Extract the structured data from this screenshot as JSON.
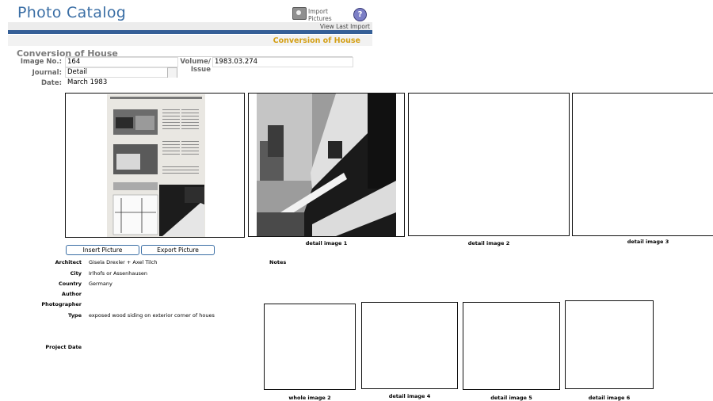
{
  "app": {
    "title": "Photo Catalog"
  },
  "toolbar": {
    "import_label": "Import Pictures",
    "import_icon": "import-pictures-icon",
    "help_icon": "help-icon",
    "view_last_import": "View Last Import"
  },
  "record": {
    "header_title": "Conversion of House",
    "section_title": "Conversion of House",
    "fields": {
      "image_no_label": "Image No.:",
      "image_no": "164",
      "journal_label": "Journal:",
      "journal": "Detail",
      "date_label": "Date:",
      "date": "March 1983",
      "volume_label": "Volume/ Issue",
      "volume": "1983.03.274"
    }
  },
  "buttons": {
    "insert_picture": "Insert Picture",
    "export_picture": "Export Picture"
  },
  "images": {
    "detail_image_1": "detail image 1",
    "detail_image_2": "detail image 2",
    "detail_image_3": "detail image 3",
    "whole_image_2": "whole image 2",
    "detail_image_4": "detail image 4",
    "detail_image_5": "detail image 5",
    "detail_image_6": "detail image 6"
  },
  "info": {
    "architect_label": "Architect",
    "architect": "Gisela Drexler + Axel Tilch",
    "city_label": "City",
    "city": "Irlhofs or Assenhausen",
    "country_label": "Country",
    "country": "Germany",
    "author_label": "Author",
    "author": "",
    "photographer_label": "Photographer",
    "photographer": "",
    "type_label": "Type",
    "type": "exposed wood siding on exterior corner of houes",
    "project_date_label": "Project Date",
    "project_date": "",
    "notes_label": "Notes"
  }
}
